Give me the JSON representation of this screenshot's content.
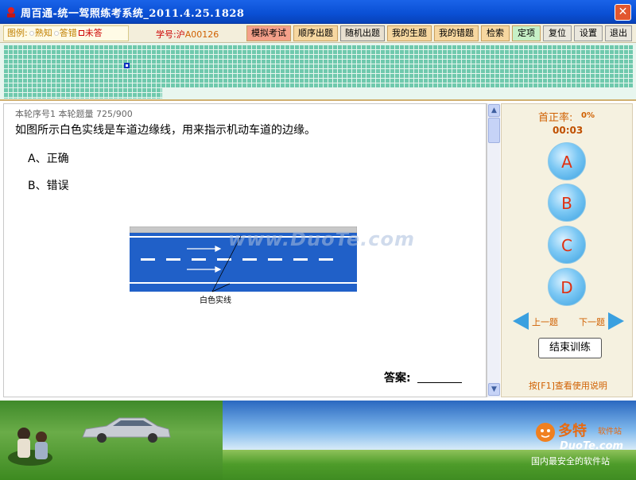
{
  "window": {
    "title": "周百通-统一驾照练考系统_2011.4.25.1828",
    "close_label": "✕"
  },
  "legend": {
    "prefix": "图例:",
    "known": "熟知",
    "wrong": "答错",
    "unanswered": "未答"
  },
  "student": {
    "label": "学号:沪",
    "id": "A00126"
  },
  "toolbar": {
    "mock_exam": "模拟考试",
    "sequential": "顺序出题",
    "random": "随机出题",
    "my_new": "我的生题",
    "my_wrong": "我的错题",
    "search": "检索",
    "fixed": "定项",
    "reset": "复位",
    "settings": "设置",
    "exit": "退出"
  },
  "question": {
    "meta": "本轮序号1  本轮题量 725/900",
    "text": "如图所示白色实线是车道边缘线，用来指示机动车道的边缘。",
    "options": [
      "A、正确",
      "B、错误"
    ],
    "figure_label": "白色实线",
    "watermark": "www.DuoTe.com",
    "answer_label": "答案:"
  },
  "panel": {
    "rate_label": "首正率:",
    "rate_value": "0%",
    "timer": "00:03",
    "answers": [
      "A",
      "B",
      "C",
      "D"
    ],
    "prev": "上一题",
    "next": "下一题",
    "end": "结束训练",
    "help": "按[F1]查看使用说明"
  },
  "banner": {
    "logo": "多特",
    "logo_sub": "软件站",
    "url": "DuoTe.com",
    "slogan": "国内最安全的软件站"
  },
  "colors": {
    "accent": "#d06000",
    "button_blue": "#3aa0e0",
    "grid": "#6fc9ad"
  }
}
